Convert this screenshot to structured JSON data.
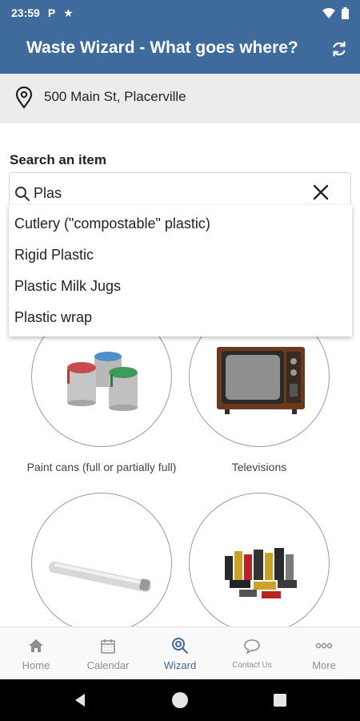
{
  "status_bar": {
    "time": "23:59",
    "icons": [
      "parking-icon",
      "star-icon",
      "wifi-icon",
      "battery-icon"
    ],
    "p_glyph": "P"
  },
  "app_bar": {
    "title": "Waste Wizard - What goes where?",
    "refresh_icon": "refresh-icon"
  },
  "address": {
    "icon": "location-pin-icon",
    "text": "500 Main St, Placerville"
  },
  "search": {
    "label": "Search an item",
    "value": "Plas",
    "suggestions": [
      "Cutlery (\"compostable\" plastic)",
      "Rigid Plastic",
      "Plastic Milk Jugs",
      "Plastic wrap"
    ]
  },
  "items": [
    {
      "label": "Paint cans (full or partially full)",
      "image": "paint-cans"
    },
    {
      "label": "Televisions",
      "image": "television"
    },
    {
      "label": "",
      "image": "fluorescent-tube"
    },
    {
      "label": "",
      "image": "batteries"
    }
  ],
  "bottom_nav": [
    {
      "label": "Home",
      "icon": "home-icon",
      "active": false
    },
    {
      "label": "Calendar",
      "icon": "calendar-icon",
      "active": false
    },
    {
      "label": "Wizard",
      "icon": "wizard-search-icon",
      "active": true
    },
    {
      "label": "Contact Us",
      "icon": "chat-bubble-icon",
      "active": false
    },
    {
      "label": "More",
      "icon": "more-dots-icon",
      "active": false
    }
  ],
  "colors": {
    "primary": "#3f6a9c",
    "address_bg": "#ececec",
    "nav_inactive": "#8e8e8e"
  }
}
